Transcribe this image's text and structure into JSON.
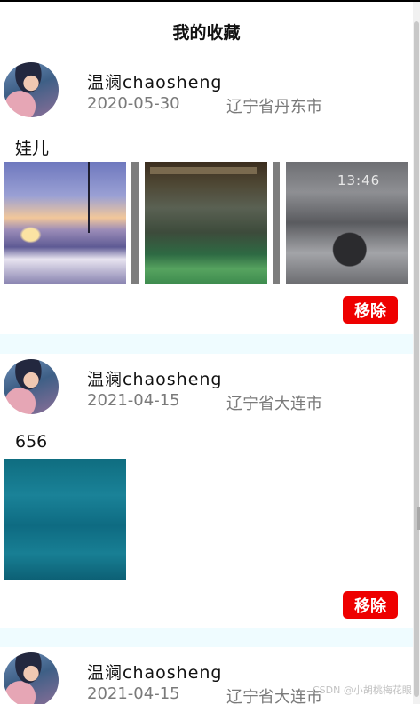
{
  "header": {
    "title": "我的收藏"
  },
  "posts": [
    {
      "user_name": "温澜chaosheng",
      "date": "2020-05-30",
      "location": "辽宁省丹东市",
      "text": "娃儿",
      "photos": [
        "sunset-road-photo",
        "shop-window-photo",
        "lockscreen-photo"
      ],
      "remove_label": "移除"
    },
    {
      "user_name": "温澜chaosheng",
      "date": "2021-04-15",
      "location": "辽宁省大连市",
      "text": "656",
      "photos": [
        "water-photo"
      ],
      "remove_label": "移除"
    },
    {
      "user_name": "温澜chaosheng",
      "date": "2021-04-15",
      "location": "辽宁省大连市"
    }
  ],
  "lock_time": "13:46",
  "watermark": "CSDN @小胡桃梅花眼",
  "colors": {
    "remove_button": "#ee0000",
    "separator": "#effcff",
    "meta_text": "#7a7a7a"
  }
}
